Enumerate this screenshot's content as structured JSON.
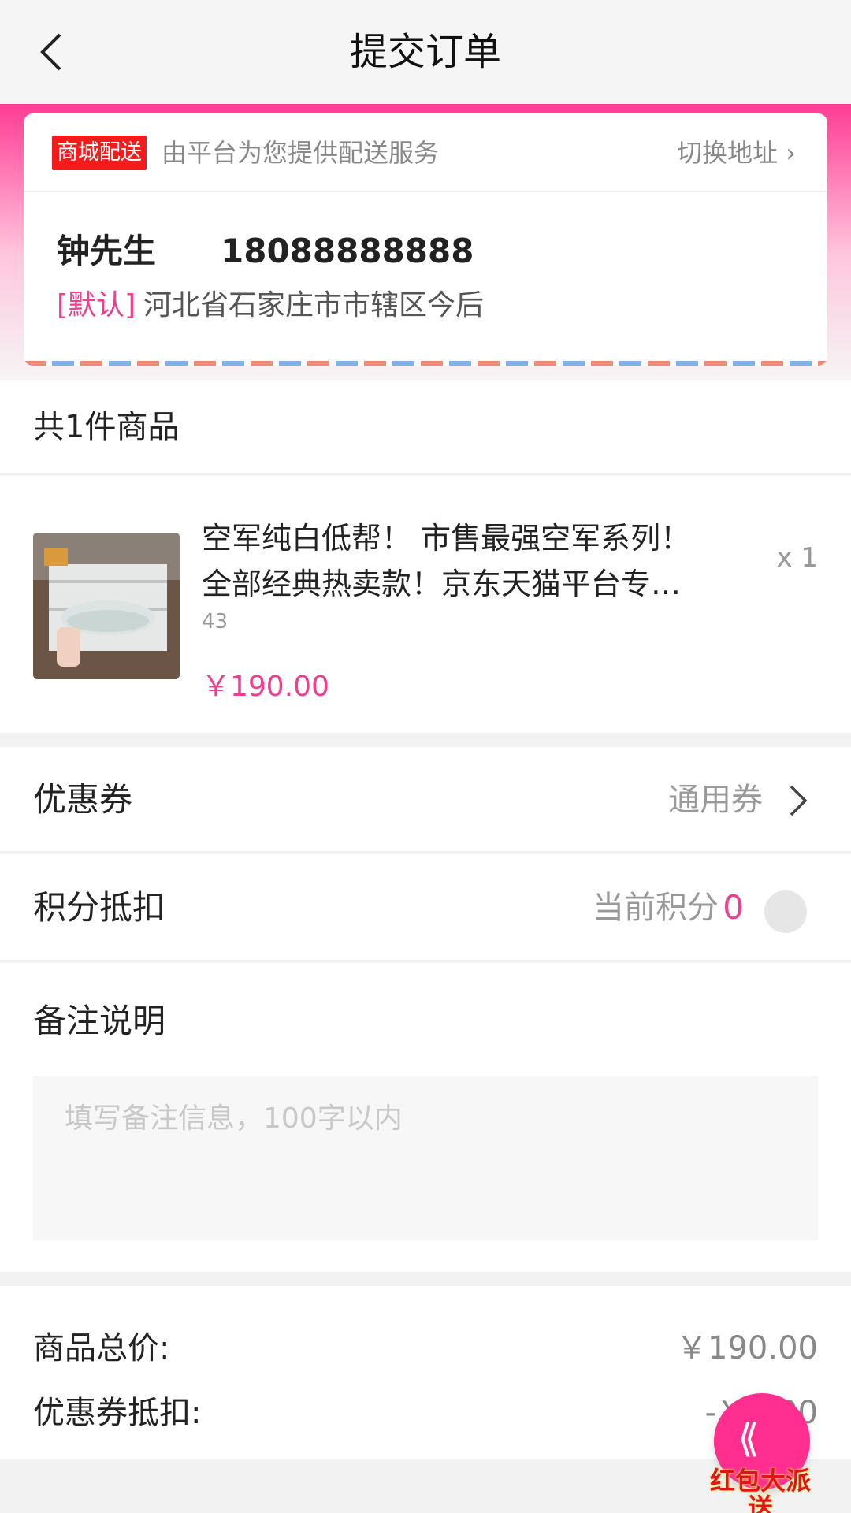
{
  "nav": {
    "title": "提交订单"
  },
  "delivery": {
    "badge": "商城配送",
    "text": "由平台为您提供配送服务",
    "switch_label": "切换地址 ›"
  },
  "address": {
    "name": "钟先生",
    "phone": "18088888888",
    "default_tag": "[默认]",
    "detail": "河北省石家庄市市辖区今后"
  },
  "order": {
    "item_count_text": "共1件商品"
  },
  "product": {
    "title": "空军纯白低帮！ 市售最强空军系列！全部经典热卖款！京东天猫平台专…",
    "quantity": "x 1",
    "spec": "43",
    "price": "￥190.00"
  },
  "coupon": {
    "label": "优惠券",
    "value": "通用券"
  },
  "points": {
    "label": "积分抵扣",
    "current_label": "当前积分",
    "current_value": "0",
    "toggle_on": false
  },
  "remark": {
    "title": "备注说明",
    "placeholder": "填写备注信息，100字以内"
  },
  "summary": {
    "total_label": "商品总价:",
    "total_value": "￥190.00",
    "coupon_label": "优惠券抵扣:",
    "coupon_value": "-￥0.00"
  },
  "floating_ad": {
    "text": "红包大派送"
  },
  "colors": {
    "accent": "#ee3f8f",
    "badge": "#f31b1b",
    "header_gradient_top": "#ff3c94"
  }
}
